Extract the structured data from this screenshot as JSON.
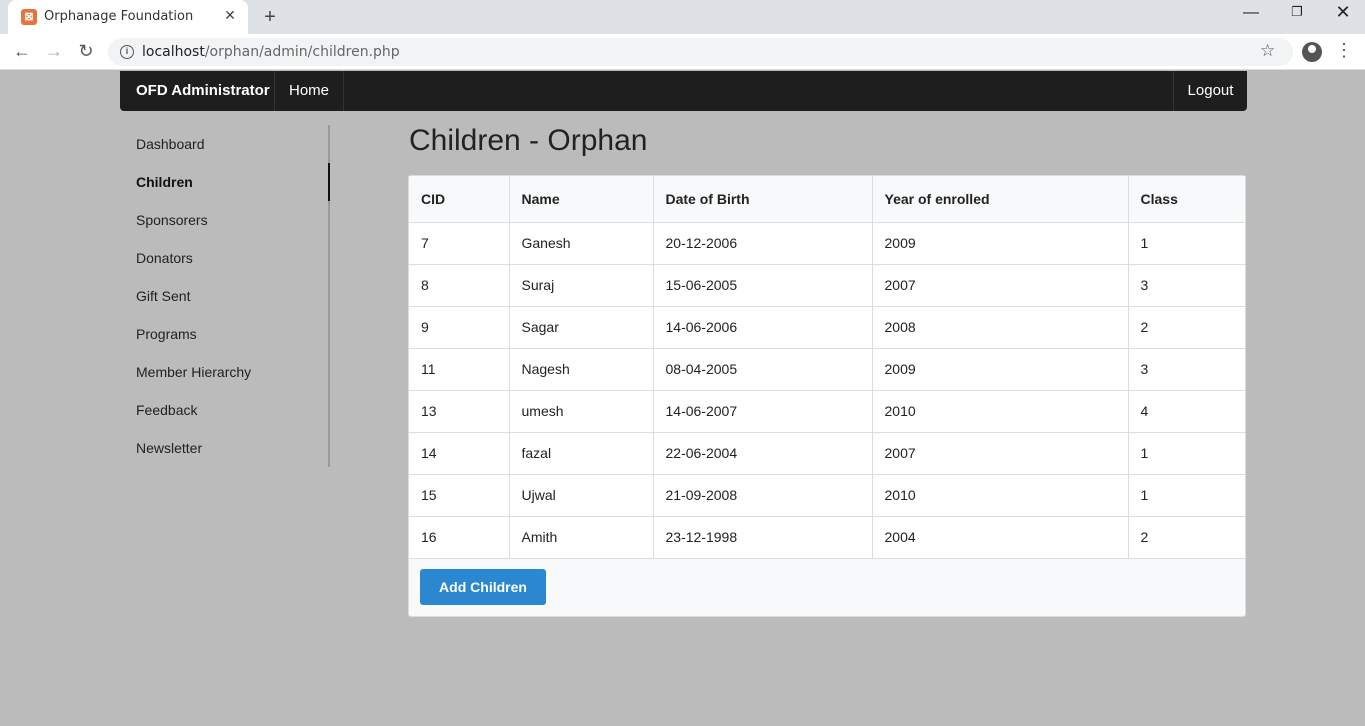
{
  "browser": {
    "tab_title": "Orphanage Foundation",
    "url_host": "localhost",
    "url_path": "/orphan/admin/children.php"
  },
  "navbar": {
    "brand": "OFD Administrator",
    "home": "Home",
    "logout": "Logout"
  },
  "sidebar": {
    "items": [
      {
        "label": "Dashboard"
      },
      {
        "label": "Children"
      },
      {
        "label": "Sponsorers"
      },
      {
        "label": "Donators"
      },
      {
        "label": "Gift Sent"
      },
      {
        "label": "Programs"
      },
      {
        "label": "Member Hierarchy"
      },
      {
        "label": "Feedback"
      },
      {
        "label": "Newsletter"
      }
    ],
    "active": "Children"
  },
  "main": {
    "title": "Children - Orphan",
    "table": {
      "headers": [
        "CID",
        "Name",
        "Date of Birth",
        "Year of enrolled",
        "Class"
      ],
      "rows": [
        [
          "7",
          "Ganesh",
          "20-12-2006",
          "2009",
          "1"
        ],
        [
          "8",
          "Suraj",
          "15-06-2005",
          "2007",
          "3"
        ],
        [
          "9",
          "Sagar",
          "14-06-2006",
          "2008",
          "2"
        ],
        [
          "11",
          "Nagesh",
          "08-04-2005",
          "2009",
          "3"
        ],
        [
          "13",
          "umesh",
          "14-06-2007",
          "2010",
          "4"
        ],
        [
          "14",
          "fazal",
          "22-06-2004",
          "2007",
          "1"
        ],
        [
          "15",
          "Ujwal",
          "21-09-2008",
          "2010",
          "1"
        ],
        [
          "16",
          "Amith",
          "23-12-1998",
          "2004",
          "2"
        ]
      ]
    },
    "add_button": "Add Children"
  }
}
